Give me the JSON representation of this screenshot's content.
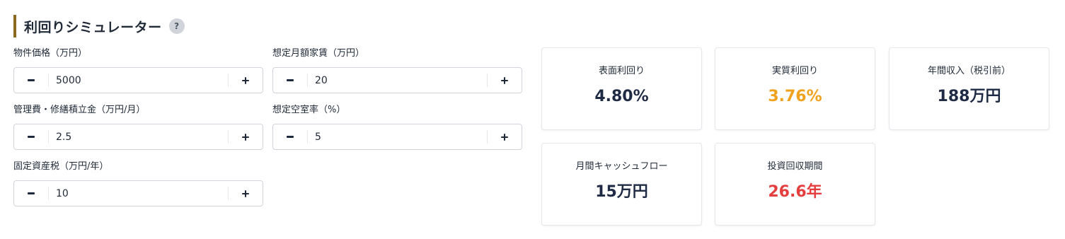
{
  "header": {
    "title": "利回りシミュレーター",
    "help_label": "?"
  },
  "inputs": [
    {
      "label": "物件価格（万円）",
      "value": "5000",
      "minus": "−",
      "plus": "+"
    },
    {
      "label": "想定月額家賃（万円）",
      "value": "20",
      "minus": "−",
      "plus": "+"
    },
    {
      "label": "管理費・修繕積立金（万円/月）",
      "value": "2.5",
      "minus": "−",
      "plus": "+"
    },
    {
      "label": "想定空室率（%）",
      "value": "5",
      "minus": "−",
      "plus": "+"
    },
    {
      "label": "固定資産税（万円/年）",
      "value": "10",
      "minus": "−",
      "plus": "+"
    }
  ],
  "results": [
    {
      "label": "表面利回り",
      "value": "4.80%",
      "color": "#1f2a44"
    },
    {
      "label": "実質利回り",
      "value": "3.76%",
      "color": "#f0a11e"
    },
    {
      "label": "年間収入（税引前）",
      "value": "188万円",
      "color": "#1f2a44"
    },
    {
      "label": "月間キャッシュフロー",
      "value": "15万円",
      "color": "#1f2a44"
    },
    {
      "label": "投資回収期間",
      "value": "26.6年",
      "color": "#e53e3e"
    }
  ],
  "colors": {
    "accent_bar": "#8b6a1f",
    "text_dark": "#1f2a44",
    "warning_orange": "#f0a11e",
    "danger_red": "#e53e3e"
  }
}
